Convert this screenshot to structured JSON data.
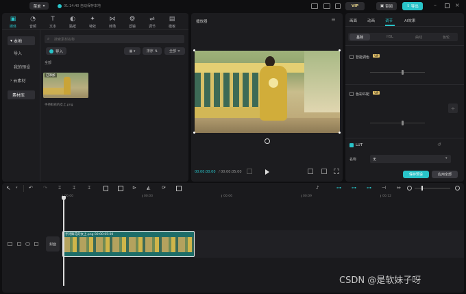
{
  "topbar": {
    "menu_label": "菜单",
    "autosave": "01:14:40 自动保存本地",
    "vip_label": "VIP",
    "review_label": "审阅",
    "export_label": "导出"
  },
  "tools": [
    {
      "label": "媒体",
      "icon": "media-icon"
    },
    {
      "label": "音频",
      "icon": "audio-icon"
    },
    {
      "label": "文本",
      "icon": "text-icon"
    },
    {
      "label": "贴纸",
      "icon": "sticker-icon"
    },
    {
      "label": "特效",
      "icon": "effects-icon"
    },
    {
      "label": "转场",
      "icon": "transition-icon"
    },
    {
      "label": "滤镜",
      "icon": "filter-icon"
    },
    {
      "label": "调节",
      "icon": "adjust-icon"
    },
    {
      "label": "模板",
      "icon": "template-icon"
    }
  ],
  "sidebar": [
    {
      "label": "本地",
      "prefix": "▾"
    },
    {
      "label": "导入",
      "prefix": ""
    },
    {
      "label": "我的预设",
      "prefix": ""
    },
    {
      "label": "云素材",
      "prefix": "›"
    },
    {
      "label": "素材库",
      "prefix": ""
    }
  ],
  "media": {
    "search_placeholder": "搜索素材名称",
    "import_label": "导入",
    "sort_label": "排序",
    "filter_label": "全部",
    "section_all": "全部",
    "item_badge": "已添加",
    "item_name": "手持鲜花的女上.png"
  },
  "player": {
    "title": "播放器",
    "time_current": "00:00:00:00",
    "time_total": "00:00:05:00"
  },
  "right": {
    "tabs": [
      "画面",
      "动画",
      "调节",
      "AI效果"
    ],
    "subtabs": [
      "基础",
      "HSL",
      "曲线",
      "色轮"
    ],
    "smart_color": "智能调色",
    "color_match": "色彩匹配",
    "lut_label": "LUT",
    "name_label": "名称",
    "name_value": "无",
    "save_preset": "保存预设",
    "apply_all": "应用全部",
    "vip_badge": "VIP"
  },
  "timeline": {
    "ticks": [
      "00:00",
      "00:03",
      "00:06",
      "00:09",
      "00:12"
    ],
    "cover_label": "封面",
    "clip_label": "手持鲜花的女上.png  00:00:05:00"
  },
  "watermark": "CSDN @是软妹子呀",
  "colors": {
    "accent": "#29c4c9",
    "panel": "#1c1c1f",
    "bg": "#0f0f11"
  }
}
